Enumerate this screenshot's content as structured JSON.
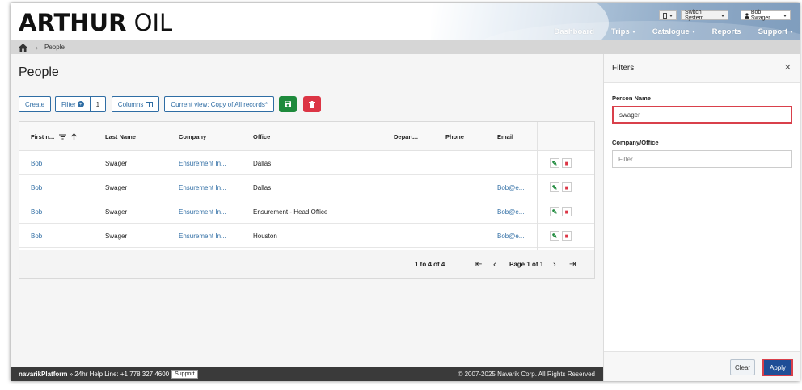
{
  "header": {
    "brand_bold": "ARTHUR",
    "brand_light": "OIL",
    "switch_system": "Switch System",
    "user": "Bob Swager",
    "nav": [
      {
        "label": "Dashboard"
      },
      {
        "label": "Trips"
      },
      {
        "label": "Catalogue"
      },
      {
        "label": "Reports"
      },
      {
        "label": "Support"
      }
    ]
  },
  "breadcrumb": {
    "current": "People"
  },
  "page": {
    "title": "People",
    "toolbar": {
      "create": "Create",
      "filter": "Filter",
      "filter_count": "1",
      "columns": "Columns",
      "current_view": "Current view: Copy of All records*"
    }
  },
  "grid": {
    "columns": [
      "First n...",
      "Last Name",
      "Company",
      "Office",
      "Depart...",
      "Phone",
      "Email"
    ],
    "rows": [
      {
        "first": "Bob",
        "last": "Swager",
        "company": "Ensurement In...",
        "office": "Dallas",
        "dept": "",
        "phone": "",
        "email": ""
      },
      {
        "first": "Bob",
        "last": "Swager",
        "company": "Ensurement In...",
        "office": "Dallas",
        "dept": "",
        "phone": "",
        "email": "Bob@e..."
      },
      {
        "first": "Bob",
        "last": "Swager",
        "company": "Ensurement In...",
        "office": "Ensurement - Head Office",
        "dept": "",
        "phone": "",
        "email": "Bob@e..."
      },
      {
        "first": "Bob",
        "last": "Swager",
        "company": "Ensurement In...",
        "office": "Houston",
        "dept": "",
        "phone": "",
        "email": "Bob@e..."
      }
    ],
    "pager": {
      "range": "1 to 4 of 4",
      "page": "Page 1 of 1"
    }
  },
  "filters": {
    "title": "Filters",
    "person_name_label": "Person Name",
    "person_name_value": "swager",
    "company_label": "Company/Office",
    "company_placeholder": "Filter...",
    "clear": "Clear",
    "apply": "Apply"
  },
  "footer": {
    "platform": "navarikPlatform",
    "helpline": " » 24hr Help Line: +1 778 327 4600",
    "support": "Support",
    "copyright": "© 2007-2025 Navarik Corp. All Rights Reserved"
  },
  "colors": {
    "accent": "#2f6da4",
    "save": "#1e8a3c",
    "delete": "#dc3545",
    "apply": "#1f4e96",
    "highlight": "#d9404b"
  }
}
